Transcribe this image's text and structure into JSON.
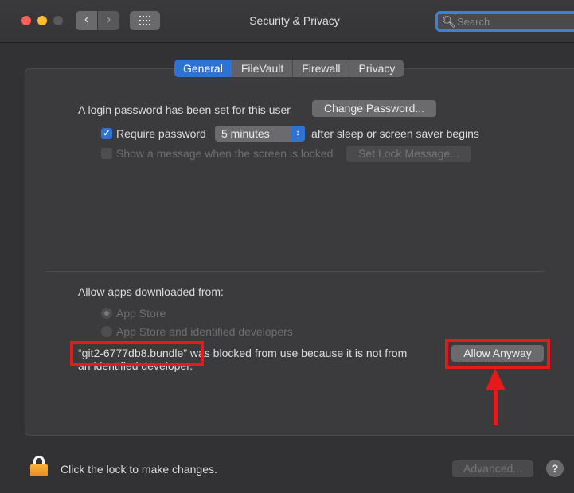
{
  "window": {
    "title": "Security & Privacy",
    "nav_back_icon": "chevron-left",
    "nav_forward_icon": "chevron-right",
    "search_placeholder": "Search"
  },
  "tabs": [
    {
      "label": "General",
      "active": true
    },
    {
      "label": "FileVault",
      "active": false
    },
    {
      "label": "Firewall",
      "active": false
    },
    {
      "label": "Privacy",
      "active": false
    }
  ],
  "general": {
    "login_password_text": "A login password has been set for this user",
    "change_password_label": "Change Password...",
    "require_password_label": "Require password",
    "require_password_checked": true,
    "require_password_delay": "5 minutes",
    "after_sleep_text": "after sleep or screen saver begins",
    "show_message_label": "Show a message when the screen is locked",
    "show_message_checked": false,
    "set_lock_message_label": "Set Lock Message..."
  },
  "allow_apps": {
    "heading": "Allow apps downloaded from:",
    "options": [
      {
        "label": "App Store",
        "selected": true
      },
      {
        "label": "App Store and identified developers",
        "selected": false
      }
    ],
    "blocked_name": "“git2-6777db8.bundle”",
    "blocked_text_rest": " was blocked from use because it is not from",
    "blocked_text_line2": "an identified developer.",
    "allow_anyway_label": "Allow Anyway"
  },
  "footer": {
    "lock_text": "Click the lock to make changes.",
    "advanced_label": "Advanced...",
    "help_label": "?"
  },
  "colors": {
    "accent": "#2e72d3",
    "annotation_red": "#e51b1b"
  }
}
